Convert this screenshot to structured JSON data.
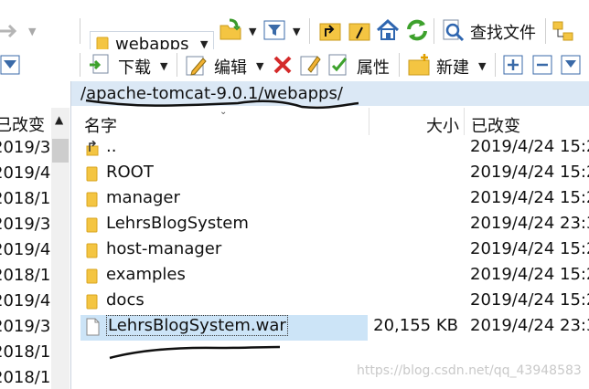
{
  "toolbar1": {
    "path_combo_value": "webapps",
    "find_files_label": "查找文件",
    "icons": [
      "forward-arrow-icon",
      "folder-icon",
      "open-folder-icon",
      "filter-icon",
      "parent-folder-icon",
      "root-folder-icon",
      "home-icon",
      "refresh-icon",
      "find-files-icon",
      "tree-view-icon"
    ]
  },
  "toolbar2": {
    "download_label": "下载",
    "edit_label": "编辑",
    "properties_label": "属性",
    "new_label": "新建",
    "icons": [
      "filter-icon",
      "download-icon",
      "edit-icon",
      "delete-icon",
      "rename-icon",
      "properties-icon",
      "new-folder-icon",
      "plus-icon",
      "minus-icon",
      "select-all-icon"
    ]
  },
  "left_pane": {
    "header": "已改变",
    "dates": [
      "2019/3",
      "2019/4",
      "2018/1",
      "2019/3",
      "2019/4",
      "2018/1",
      "2019/4",
      "2019/3",
      "2018/1",
      "2018/1"
    ]
  },
  "path_bar": {
    "path": "/apache-tomcat-9.0.1/webapps/"
  },
  "file_list": {
    "columns": {
      "name": "名字",
      "size": "大小",
      "modified": "已改变"
    },
    "rows": [
      {
        "name": "..",
        "size": "",
        "modified": "2019/4/24 15:2",
        "type": "parent"
      },
      {
        "name": "ROOT",
        "size": "",
        "modified": "2019/4/24 15:2",
        "type": "folder"
      },
      {
        "name": "manager",
        "size": "",
        "modified": "2019/4/24 15:2",
        "type": "folder"
      },
      {
        "name": "LehrsBlogSystem",
        "size": "",
        "modified": "2019/4/24 23:3",
        "type": "folder"
      },
      {
        "name": "host-manager",
        "size": "",
        "modified": "2019/4/24 15:2",
        "type": "folder"
      },
      {
        "name": "examples",
        "size": "",
        "modified": "2019/4/24 15:2",
        "type": "folder"
      },
      {
        "name": "docs",
        "size": "",
        "modified": "2019/4/24 15:2",
        "type": "folder"
      },
      {
        "name": "LehrsBlogSystem.war",
        "size": "20,155 KB",
        "modified": "2019/4/24 23:3",
        "type": "file",
        "selected": true
      }
    ]
  },
  "watermark": "https://blog.csdn.net/qq_43948583",
  "colors": {
    "path_bar_bg": "#dbe8f5",
    "selection_bg": "#cce4f7",
    "folder_yellow": "#f4c542",
    "annotation_ink": "#111111"
  }
}
